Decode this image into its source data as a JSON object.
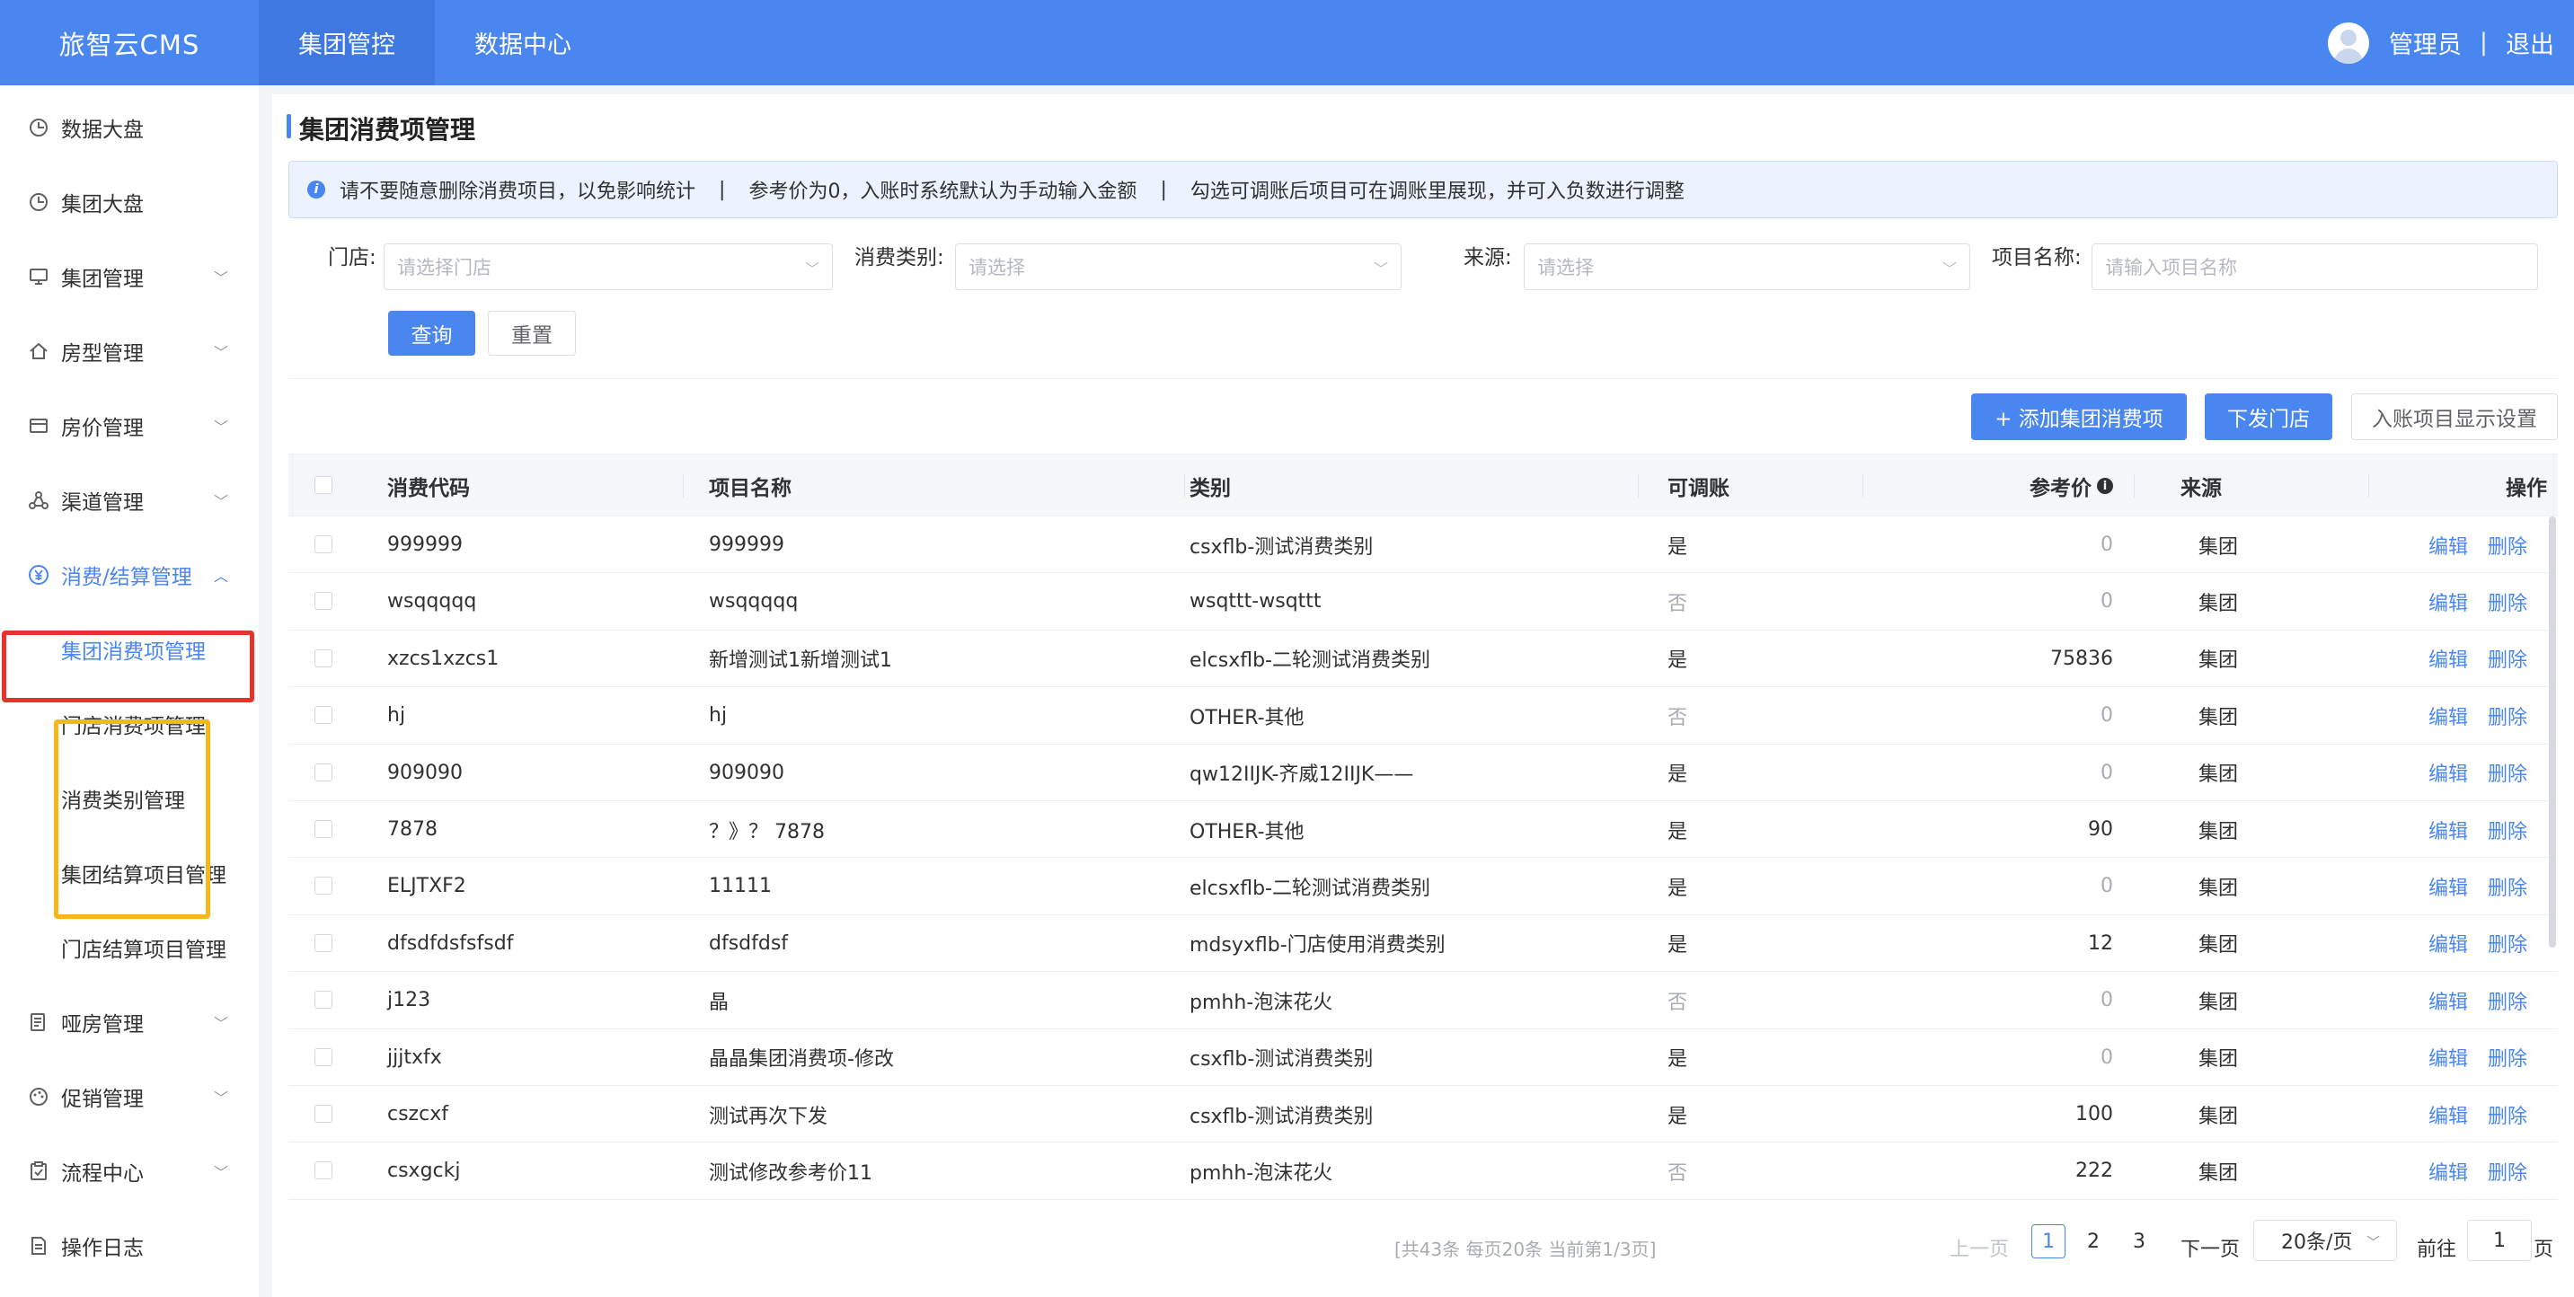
{
  "app": {
    "brand": "旅智云CMS"
  },
  "topnav": {
    "items": [
      "集团管控",
      "数据中心"
    ]
  },
  "user": {
    "name": "管理员",
    "separator": "|",
    "logout": "退出"
  },
  "sidebar": {
    "items": [
      {
        "label": "数据大盘",
        "icon": "clock-icon"
      },
      {
        "label": "集团大盘",
        "icon": "clock-icon"
      },
      {
        "label": "集团管理",
        "icon": "monitor-icon"
      },
      {
        "label": "房型管理",
        "icon": "home-icon"
      },
      {
        "label": "房价管理",
        "icon": "card-icon"
      },
      {
        "label": "渠道管理",
        "icon": "share-icon"
      },
      {
        "label": "消费/结算管理",
        "icon": "yuan-icon"
      },
      {
        "label": "哑房管理",
        "icon": "document-icon"
      },
      {
        "label": "促销管理",
        "icon": "palette-icon"
      },
      {
        "label": "流程中心",
        "icon": "clipboard-icon"
      },
      {
        "label": "操作日志",
        "icon": "file-icon"
      }
    ],
    "sub_items": [
      "集团消费项管理",
      "门店消费项管理",
      "消费类别管理",
      "集团结算项目管理",
      "门店结算项目管理"
    ]
  },
  "page": {
    "title": "集团消费项管理"
  },
  "notice": {
    "items": [
      "请不要随意删除消费项目，以免影响统计",
      "参考价为0，入账时系统默认为手动输入金额",
      "勾选可调账后项目可在调账里展现，并可入负数进行调整"
    ],
    "separator": "|"
  },
  "filters": {
    "store_label": "门店:",
    "store_placeholder": "请选择门店",
    "category_label": "消费类别:",
    "category_placeholder": "请选择",
    "source_label": "来源:",
    "source_placeholder": "请选择",
    "name_label": "项目名称:",
    "name_placeholder": "请输入项目名称",
    "query": "查询",
    "reset": "重置"
  },
  "actions": {
    "add": "+ 添加集团消费项",
    "distribute": "下发门店",
    "display_settings": "入账项目显示设置"
  },
  "table": {
    "columns": [
      "消费代码",
      "项目名称",
      "类别",
      "可调账",
      "参考价",
      "来源",
      "操作"
    ],
    "edit": "编辑",
    "delete": "删除",
    "rows": [
      {
        "code": "999999",
        "name": "999999",
        "category": "csxflb-测试消费类别",
        "adjust": "是",
        "price": "0",
        "source": "集团"
      },
      {
        "code": "wsqqqqq",
        "name": "wsqqqqq",
        "category": "wsqttt-wsqttt",
        "adjust": "否",
        "price": "0",
        "source": "集团"
      },
      {
        "code": "xzcs1xzcs1",
        "name": "新增测试1新增测试1",
        "category": "elcsxflb-二轮测试消费类别",
        "adjust": "是",
        "price": "75836",
        "source": "集团"
      },
      {
        "code": "hj",
        "name": "hj",
        "category": "OTHER-其他",
        "adjust": "否",
        "price": "0",
        "source": "集团"
      },
      {
        "code": "909090",
        "name": "909090",
        "category": "qw12IIJK-齐威12IIJK——",
        "adjust": "是",
        "price": "0",
        "source": "集团"
      },
      {
        "code": "7878",
        "name": "？》？ 7878",
        "category": "OTHER-其他",
        "adjust": "是",
        "price": "90",
        "source": "集团"
      },
      {
        "code": "ELJTXF2",
        "name": "11111",
        "category": "elcsxflb-二轮测试消费类别",
        "adjust": "是",
        "price": "0",
        "source": "集团"
      },
      {
        "code": "dfsdfdsfsfsdf",
        "name": "dfsdfdsf",
        "category": "mdsyxflb-门店使用消费类别",
        "adjust": "是",
        "price": "12",
        "source": "集团"
      },
      {
        "code": "j123",
        "name": "晶",
        "category": "pmhh-泡沫花火",
        "adjust": "否",
        "price": "0",
        "source": "集团"
      },
      {
        "code": "jjjtxfx",
        "name": "晶晶集团消费项-修改",
        "category": "csxflb-测试消费类别",
        "adjust": "是",
        "price": "0",
        "source": "集团"
      },
      {
        "code": "cszcxf",
        "name": "测试再次下发",
        "category": "csxflb-测试消费类别",
        "adjust": "是",
        "price": "100",
        "source": "集团"
      },
      {
        "code": "csxgckj",
        "name": "测试修改参考价11",
        "category": "pmhh-泡沫花火",
        "adjust": "否",
        "price": "222",
        "source": "集团"
      }
    ]
  },
  "pagination": {
    "summary": "[共43条 每页20条 当前第1/3页]",
    "prev": "上一页",
    "pages": [
      "1",
      "2",
      "3"
    ],
    "current_page": 1,
    "next": "下一页",
    "page_size": "20条/页",
    "goto_label": "前往",
    "goto_value": "1",
    "page_unit": "页"
  },
  "colors": {
    "primary": "#4a86f0",
    "highlight_red": "#e5342b",
    "highlight_yellow": "#f7b718"
  }
}
